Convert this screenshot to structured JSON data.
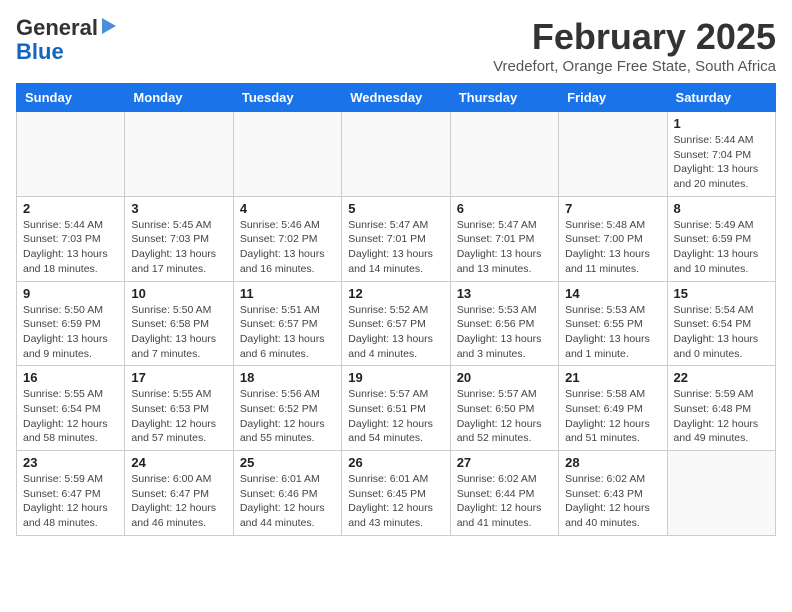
{
  "logo": {
    "text1": "General",
    "text2": "Blue"
  },
  "title": "February 2025",
  "location": "Vredefort, Orange Free State, South Africa",
  "days_of_week": [
    "Sunday",
    "Monday",
    "Tuesday",
    "Wednesday",
    "Thursday",
    "Friday",
    "Saturday"
  ],
  "weeks": [
    [
      {
        "day": "",
        "info": ""
      },
      {
        "day": "",
        "info": ""
      },
      {
        "day": "",
        "info": ""
      },
      {
        "day": "",
        "info": ""
      },
      {
        "day": "",
        "info": ""
      },
      {
        "day": "",
        "info": ""
      },
      {
        "day": "1",
        "info": "Sunrise: 5:44 AM\nSunset: 7:04 PM\nDaylight: 13 hours\nand 20 minutes."
      }
    ],
    [
      {
        "day": "2",
        "info": "Sunrise: 5:44 AM\nSunset: 7:03 PM\nDaylight: 13 hours\nand 18 minutes."
      },
      {
        "day": "3",
        "info": "Sunrise: 5:45 AM\nSunset: 7:03 PM\nDaylight: 13 hours\nand 17 minutes."
      },
      {
        "day": "4",
        "info": "Sunrise: 5:46 AM\nSunset: 7:02 PM\nDaylight: 13 hours\nand 16 minutes."
      },
      {
        "day": "5",
        "info": "Sunrise: 5:47 AM\nSunset: 7:01 PM\nDaylight: 13 hours\nand 14 minutes."
      },
      {
        "day": "6",
        "info": "Sunrise: 5:47 AM\nSunset: 7:01 PM\nDaylight: 13 hours\nand 13 minutes."
      },
      {
        "day": "7",
        "info": "Sunrise: 5:48 AM\nSunset: 7:00 PM\nDaylight: 13 hours\nand 11 minutes."
      },
      {
        "day": "8",
        "info": "Sunrise: 5:49 AM\nSunset: 6:59 PM\nDaylight: 13 hours\nand 10 minutes."
      }
    ],
    [
      {
        "day": "9",
        "info": "Sunrise: 5:50 AM\nSunset: 6:59 PM\nDaylight: 13 hours\nand 9 minutes."
      },
      {
        "day": "10",
        "info": "Sunrise: 5:50 AM\nSunset: 6:58 PM\nDaylight: 13 hours\nand 7 minutes."
      },
      {
        "day": "11",
        "info": "Sunrise: 5:51 AM\nSunset: 6:57 PM\nDaylight: 13 hours\nand 6 minutes."
      },
      {
        "day": "12",
        "info": "Sunrise: 5:52 AM\nSunset: 6:57 PM\nDaylight: 13 hours\nand 4 minutes."
      },
      {
        "day": "13",
        "info": "Sunrise: 5:53 AM\nSunset: 6:56 PM\nDaylight: 13 hours\nand 3 minutes."
      },
      {
        "day": "14",
        "info": "Sunrise: 5:53 AM\nSunset: 6:55 PM\nDaylight: 13 hours\nand 1 minute."
      },
      {
        "day": "15",
        "info": "Sunrise: 5:54 AM\nSunset: 6:54 PM\nDaylight: 13 hours\nand 0 minutes."
      }
    ],
    [
      {
        "day": "16",
        "info": "Sunrise: 5:55 AM\nSunset: 6:54 PM\nDaylight: 12 hours\nand 58 minutes."
      },
      {
        "day": "17",
        "info": "Sunrise: 5:55 AM\nSunset: 6:53 PM\nDaylight: 12 hours\nand 57 minutes."
      },
      {
        "day": "18",
        "info": "Sunrise: 5:56 AM\nSunset: 6:52 PM\nDaylight: 12 hours\nand 55 minutes."
      },
      {
        "day": "19",
        "info": "Sunrise: 5:57 AM\nSunset: 6:51 PM\nDaylight: 12 hours\nand 54 minutes."
      },
      {
        "day": "20",
        "info": "Sunrise: 5:57 AM\nSunset: 6:50 PM\nDaylight: 12 hours\nand 52 minutes."
      },
      {
        "day": "21",
        "info": "Sunrise: 5:58 AM\nSunset: 6:49 PM\nDaylight: 12 hours\nand 51 minutes."
      },
      {
        "day": "22",
        "info": "Sunrise: 5:59 AM\nSunset: 6:48 PM\nDaylight: 12 hours\nand 49 minutes."
      }
    ],
    [
      {
        "day": "23",
        "info": "Sunrise: 5:59 AM\nSunset: 6:47 PM\nDaylight: 12 hours\nand 48 minutes."
      },
      {
        "day": "24",
        "info": "Sunrise: 6:00 AM\nSunset: 6:47 PM\nDaylight: 12 hours\nand 46 minutes."
      },
      {
        "day": "25",
        "info": "Sunrise: 6:01 AM\nSunset: 6:46 PM\nDaylight: 12 hours\nand 44 minutes."
      },
      {
        "day": "26",
        "info": "Sunrise: 6:01 AM\nSunset: 6:45 PM\nDaylight: 12 hours\nand 43 minutes."
      },
      {
        "day": "27",
        "info": "Sunrise: 6:02 AM\nSunset: 6:44 PM\nDaylight: 12 hours\nand 41 minutes."
      },
      {
        "day": "28",
        "info": "Sunrise: 6:02 AM\nSunset: 6:43 PM\nDaylight: 12 hours\nand 40 minutes."
      },
      {
        "day": "",
        "info": ""
      }
    ]
  ]
}
